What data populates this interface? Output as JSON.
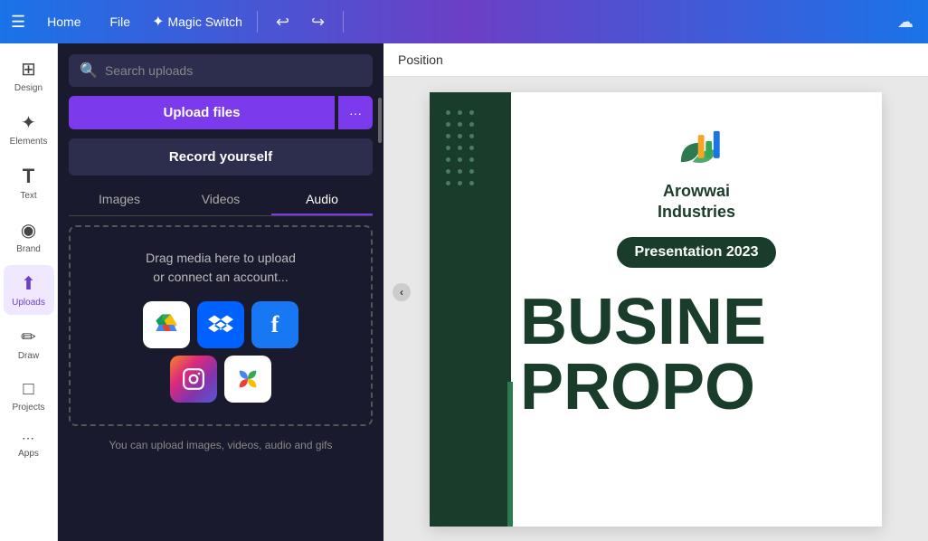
{
  "topnav": {
    "menu_icon": "☰",
    "home_label": "Home",
    "file_label": "File",
    "magic_switch_label": "Magic Switch",
    "magic_star": "✦",
    "undo_icon": "↩",
    "redo_icon": "↪",
    "cloud_icon": "☁"
  },
  "sidebar": {
    "items": [
      {
        "id": "design",
        "icon": "⊞",
        "label": "Design"
      },
      {
        "id": "elements",
        "icon": "✦",
        "label": "Elements"
      },
      {
        "id": "text",
        "icon": "T",
        "label": "Text"
      },
      {
        "id": "brand",
        "icon": "◉",
        "label": "Brand"
      },
      {
        "id": "uploads",
        "icon": "⬆",
        "label": "Uploads",
        "active": true
      },
      {
        "id": "draw",
        "icon": "✏",
        "label": "Draw"
      },
      {
        "id": "projects",
        "icon": "□",
        "label": "Projects"
      },
      {
        "id": "apps",
        "icon": "⋯",
        "label": "Apps"
      }
    ]
  },
  "upload_panel": {
    "search_placeholder": "Search uploads",
    "upload_files_label": "Upload files",
    "more_options_label": "···",
    "record_label": "Record yourself",
    "tabs": [
      {
        "id": "images",
        "label": "Images",
        "active": false
      },
      {
        "id": "videos",
        "label": "Videos",
        "active": false
      },
      {
        "id": "audio",
        "label": "Audio",
        "active": true
      }
    ],
    "drop_zone_line1": "Drag media here to upload",
    "drop_zone_line2": "or connect an account...",
    "services": [
      {
        "id": "gdrive",
        "icon": "🔵",
        "label": "Google Drive"
      },
      {
        "id": "dropbox",
        "icon": "📦",
        "label": "Dropbox"
      },
      {
        "id": "facebook",
        "icon": "f",
        "label": "Facebook"
      },
      {
        "id": "instagram",
        "icon": "📷",
        "label": "Instagram"
      },
      {
        "id": "gphotos",
        "icon": "🌸",
        "label": "Google Photos"
      }
    ],
    "hint_text": "You can upload images, videos, audio and gifs"
  },
  "canvas": {
    "position_label": "Position",
    "collapse_icon": "‹"
  },
  "slide": {
    "company_name": "Arowwai\nIndustries",
    "presentation_badge": "Presentation 2023",
    "big_text_line1": "BUSINE",
    "big_text_line2": "PROPO"
  }
}
